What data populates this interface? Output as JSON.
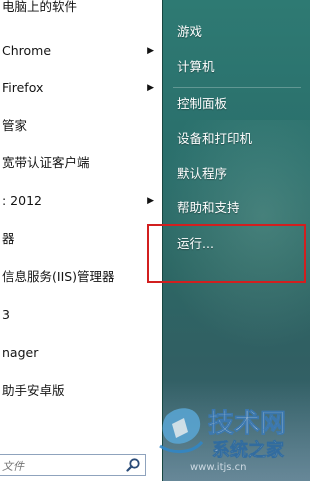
{
  "left_pane": {
    "items": [
      {
        "label": "电脑上的软件",
        "has_arrow": false
      },
      {
        "label": "Chrome",
        "has_arrow": true
      },
      {
        "label": "Firefox",
        "has_arrow": true
      },
      {
        "label": "管家",
        "has_arrow": false
      },
      {
        "label": "宽带认证客户端",
        "has_arrow": false
      },
      {
        "label": ": 2012",
        "has_arrow": true
      },
      {
        "label": "器",
        "has_arrow": false
      },
      {
        "label": "信息服务(IIS)管理器",
        "has_arrow": false
      },
      {
        "label": "3",
        "has_arrow": false
      },
      {
        "label": "nager",
        "has_arrow": false
      },
      {
        "label": "助手安卓版",
        "has_arrow": false
      }
    ],
    "arrow_glyph": "▶",
    "search": {
      "placeholder": "文件"
    }
  },
  "right_pane": {
    "items": [
      {
        "label": "游戏"
      },
      {
        "label": "计算机"
      },
      {
        "label": "控制面板"
      },
      {
        "label": "设备和打印机"
      },
      {
        "label": "默认程序"
      },
      {
        "label": "帮助和支持"
      },
      {
        "label": "运行..."
      }
    ]
  },
  "highlight_color": "#d21f1f",
  "watermark": {
    "line1": "技术网",
    "line2": "系统之家",
    "url": "www.itjs.cn"
  }
}
